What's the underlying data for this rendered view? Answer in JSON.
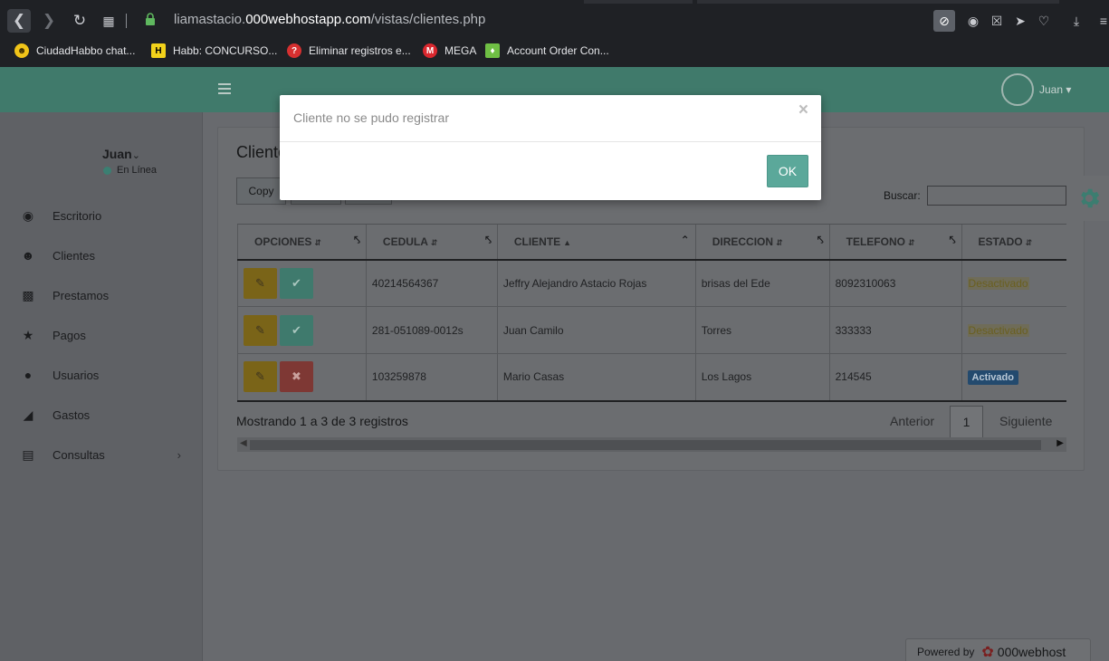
{
  "browser": {
    "url_prefix": "liamastacio.",
    "url_domain": "000webhostapp.com",
    "url_path": "/vistas/clientes.php",
    "bookmarks": [
      {
        "label": "CiudadHabbo chat..."
      },
      {
        "label": "Habb: CONCURSO..."
      },
      {
        "label": "Eliminar registros e..."
      },
      {
        "label": "MEGA"
      },
      {
        "label": "Account Order Con..."
      }
    ]
  },
  "header": {
    "user_label": "Juan ▾"
  },
  "sidebar": {
    "user_name": "Juan",
    "status": "En Línea",
    "items": [
      {
        "label": "Escritorio",
        "icon": "dashboard-icon"
      },
      {
        "label": "Clientes",
        "icon": "users-icon"
      },
      {
        "label": "Prestamos",
        "icon": "money-icon"
      },
      {
        "label": "Pagos",
        "icon": "star-icon"
      },
      {
        "label": "Usuarios",
        "icon": "user-icon"
      },
      {
        "label": "Gastos",
        "icon": "megaphone-icon"
      },
      {
        "label": "Consultas",
        "icon": "bar-chart-icon"
      }
    ]
  },
  "main": {
    "title": "Cliente",
    "copy_label": "Copy",
    "search_label": "Buscar:",
    "columns": [
      "OPCIONES",
      "CEDULA",
      "CLIENTE",
      "DIRECCION",
      "TELEFONO",
      "ESTADO"
    ],
    "rows": [
      {
        "cedula": "40214564367",
        "cliente": "Jeffry Alejandro Astacio Rojas",
        "direccion": "brisas del Ede",
        "telefono": "8092310063",
        "estado": "Desactivado"
      },
      {
        "cedula": "281-051089-0012s",
        "cliente": "Juan Camilo",
        "direccion": "Torres",
        "telefono": "333333",
        "estado": "Desactivado"
      },
      {
        "cedula": "103259878",
        "cliente": "Mario Casas",
        "direccion": "Los Lagos",
        "telefono": "214545",
        "estado": "Activado"
      }
    ],
    "info": "Mostrando 1 a 3 de 3 registros",
    "pagination": {
      "prev": "Anterior",
      "page": "1",
      "next": "Siguiente"
    }
  },
  "footer": {
    "powered_by": "Powered by",
    "brand": "000webhost"
  },
  "modal": {
    "message": "Cliente no se pudo registrar",
    "close": "×",
    "ok_label": "OK"
  },
  "colors": {
    "accent": "#5ba89a",
    "edit": "#e6ac12",
    "danger": "#d9534f",
    "active_badge": "#337ab7"
  }
}
